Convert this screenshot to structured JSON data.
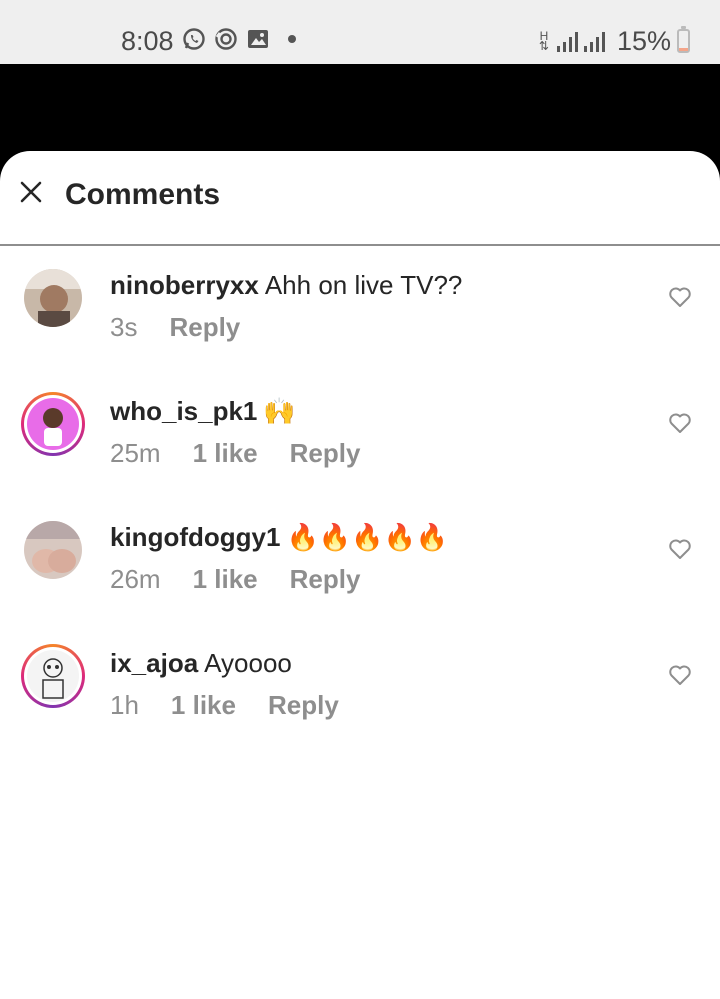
{
  "status_bar": {
    "time": "8:08",
    "icons": [
      "whatsapp-icon",
      "sync-icon",
      "image-icon"
    ],
    "data_indicator": "H",
    "battery_text": "15%",
    "battery_level": 0.15
  },
  "sheet": {
    "title": "Comments",
    "close_icon": "close-icon"
  },
  "comments": [
    {
      "user": "ninoberryxx",
      "text": "Ahh on live TV??",
      "time": "3s",
      "likes": "",
      "reply": "Reply"
    },
    {
      "user": "who_is_pk1",
      "text": "🙌",
      "time": "25m",
      "likes": "1 like",
      "reply": "Reply"
    },
    {
      "user": "kingofdoggy1",
      "text": "🔥🔥🔥🔥🔥",
      "time": "26m",
      "likes": "1 like",
      "reply": "Reply"
    },
    {
      "user": "ix_ajoa",
      "text": "Ayoooo",
      "time": "1h",
      "likes": "1 like",
      "reply": "Reply"
    }
  ],
  "colors": {
    "status_bar_bg": "#efefef",
    "secondary_text": "#8e8e8e",
    "primary_text": "#262626",
    "story_ring": "#dd2a7b"
  }
}
